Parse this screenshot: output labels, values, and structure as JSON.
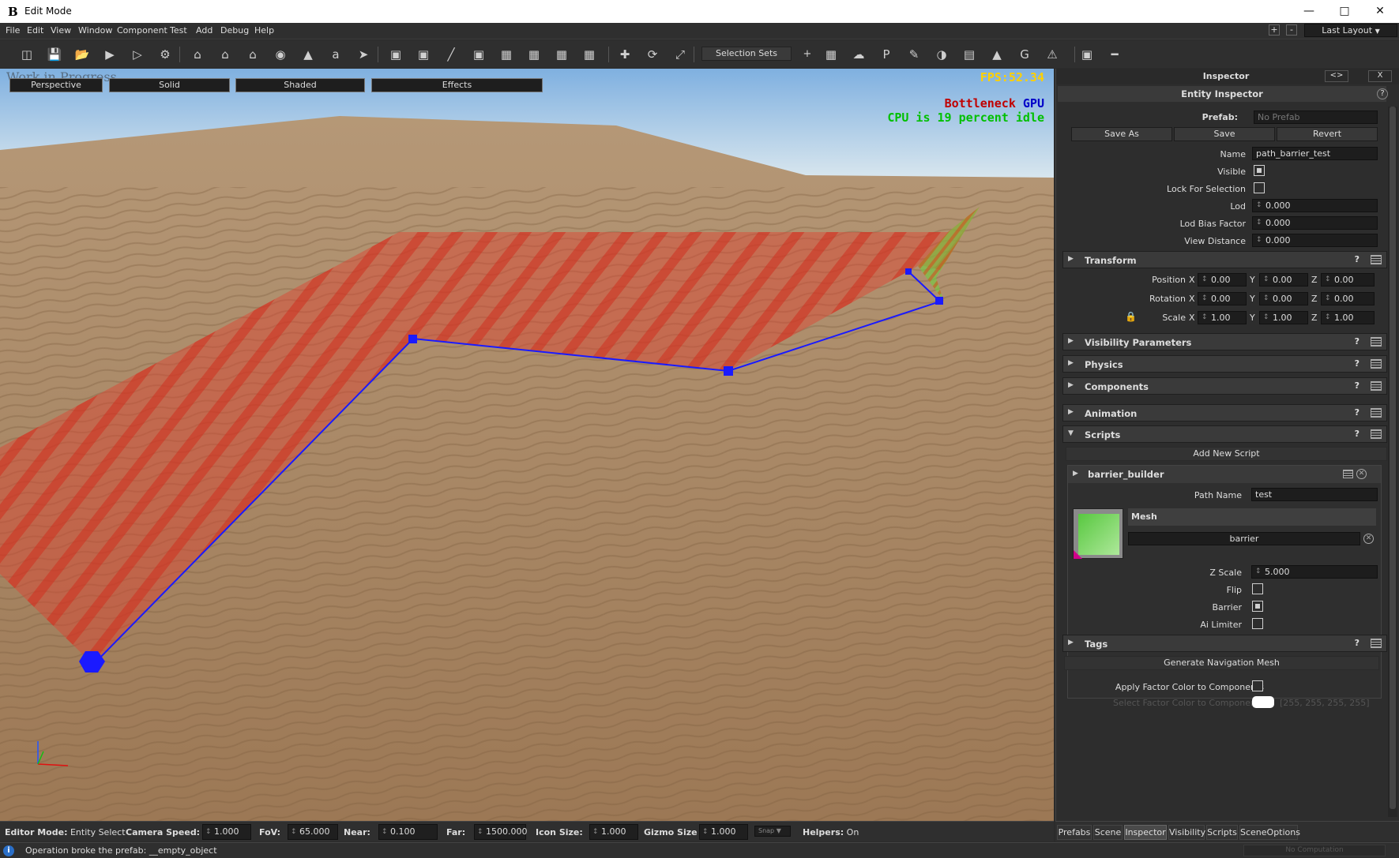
{
  "window": {
    "app_icon": "blender-b-icon",
    "logo_glyph": "B",
    "title": "Edit Mode",
    "minimize": "—",
    "maximize": "□",
    "close": "✕"
  },
  "menu": [
    "File",
    "Edit",
    "View",
    "Window",
    "Component",
    "Test",
    "Add",
    "Debug",
    "Help"
  ],
  "layout": {
    "plus": "+",
    "minus": "-",
    "selected": "Last Layout"
  },
  "toolbar": {
    "selection_sets": "Selection Sets",
    "add": "+"
  },
  "viewport": {
    "watermark": "Work in Progress",
    "tabs": [
      "Perspective",
      "Solid",
      "Shaded",
      "Effects"
    ],
    "fps": "FPS:52.34",
    "bottleneck_label": "Bottleneck",
    "bottleneck_value": "GPU",
    "cpu_idle": "CPU is 19 percent idle"
  },
  "statusbar": {
    "editor_mode_label": "Editor Mode:",
    "editor_mode_value": "Entity Select",
    "camera_speed_label": "Camera Speed:",
    "camera_speed": "1.000",
    "fov_label": "FoV:",
    "fov": "65.000",
    "near_label": "Near:",
    "near": "0.100",
    "far_label": "Far:",
    "far": "1500.000",
    "icon_size_label": "Icon Size:",
    "icon_size": "1.000",
    "gizmo_size_label": "Gizmo Size",
    "gizmo_size": "1.000",
    "snap": "Snap",
    "helpers_label": "Helpers:",
    "helpers_value": "On"
  },
  "message": {
    "icon": "info-icon",
    "text": "Operation broke the prefab: __empty_object"
  },
  "inspector": {
    "title": "Inspector",
    "toggle": "<>",
    "close": "X",
    "entity_title": "Entity Inspector",
    "help": "?",
    "prefab_label": "Prefab:",
    "prefab_value": "No Prefab",
    "save_as": "Save As",
    "save": "Save",
    "revert": "Revert",
    "name_label": "Name",
    "name_value": "path_barrier_test",
    "visible_label": "Visible",
    "visible": true,
    "lock_label": "Lock For Selection",
    "lock": false,
    "lod_label": "Lod",
    "lod": "0.000",
    "lod_bias_label": "Lod Bias Factor",
    "lod_bias": "0.000",
    "view_distance_label": "View Distance",
    "view_distance": "0.000",
    "sections": {
      "transform": "Transform",
      "visibility": "Visibility Parameters",
      "physics": "Physics",
      "components": "Components",
      "animation": "Animation",
      "scripts": "Scripts",
      "tags": "Tags"
    },
    "transform": {
      "position_label": "Position",
      "rotation_label": "Rotation",
      "scale_label": "Scale",
      "x": "X",
      "y": "Y",
      "z": "Z",
      "position": [
        "0.00",
        "0.00",
        "0.00"
      ],
      "rotation": [
        "0.00",
        "0.00",
        "0.00"
      ],
      "scale": [
        "1.00",
        "1.00",
        "1.00"
      ]
    },
    "add_script": "Add New Script",
    "script": {
      "name": "barrier_builder",
      "path_name_label": "Path Name",
      "path_name": "test",
      "mesh_label": "Mesh",
      "mesh_value": "barrier",
      "z_scale_label": "Z Scale",
      "z_scale": "5.000",
      "flip_label": "Flip",
      "flip": false,
      "barrier_label": "Barrier",
      "barrier": true,
      "ai_limiter_label": "Ai Limiter",
      "ai_limiter": false
    },
    "generate_nav": "Generate Navigation Mesh",
    "apply_factor_label": "Apply Factor Color to Components",
    "apply_factor": false,
    "select_factor_label": "Select Factor Color to Components",
    "factor_color_value": "[255, 255, 255, 255]",
    "footer_text": "No Computation"
  },
  "bottom_tabs": [
    "Prefabs",
    "Scene",
    "Inspector",
    "Visibility",
    "Scripts",
    "SceneOptions"
  ],
  "active_bottom_tab": "Inspector",
  "colors": {
    "sky_top": "#7fb0e0",
    "sky_bottom": "#d8e6ee",
    "sand": "#a98766",
    "barrier": "#e0402f",
    "endcap": "#6fcf40",
    "path_line": "#1a1aff",
    "fps": "#ffd000",
    "bottleneck": "#c00000",
    "gpu": "#0000c8",
    "cpu": "#00c000"
  }
}
